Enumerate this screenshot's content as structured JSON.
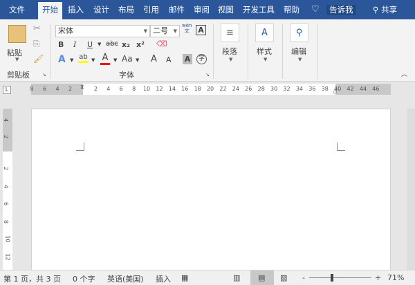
{
  "tabs": [
    "文件",
    "开始",
    "插入",
    "设计",
    "布局",
    "引用",
    "邮件",
    "审阅",
    "视图",
    "开发工具",
    "帮助"
  ],
  "tell_me": "告诉我",
  "share": "共享",
  "clipboard": {
    "paste": "粘贴",
    "label": "剪贴板"
  },
  "font": {
    "name": "宋体",
    "size": "二号",
    "label": "字体",
    "bold": "B",
    "italic": "I",
    "underline": "U",
    "strike": "abc",
    "sub": "x₂",
    "sup": "x²",
    "case": "Aa",
    "grow": "A",
    "shrink": "A",
    "phonetic": "wén\n文",
    "border_a": "A",
    "shade_a": "A",
    "circle": "字"
  },
  "paragraph": {
    "label": "段落"
  },
  "styles": {
    "label": "样式"
  },
  "editing": {
    "label": "编辑"
  },
  "ruler": {
    "left": [
      "8",
      "6",
      "4",
      "2"
    ],
    "right": [
      "2",
      "4",
      "6",
      "8",
      "10",
      "12",
      "14",
      "16",
      "18",
      "20",
      "22",
      "24",
      "26",
      "28",
      "30",
      "32",
      "34",
      "36",
      "38",
      "40",
      "42",
      "44",
      "46"
    ],
    "vertical_top": [
      "4",
      "2"
    ],
    "vertical": [
      "2",
      "4",
      "6",
      "8",
      "10",
      "12"
    ]
  },
  "status": {
    "page": "第 1 页，共 3 页",
    "words": "0 个字",
    "lang": "英语(美国)",
    "mode": "插入",
    "zoom": "71%"
  },
  "colors": {
    "accent": "#2b579a",
    "highlight": "#ffff00",
    "font_color": "#ff0000"
  }
}
